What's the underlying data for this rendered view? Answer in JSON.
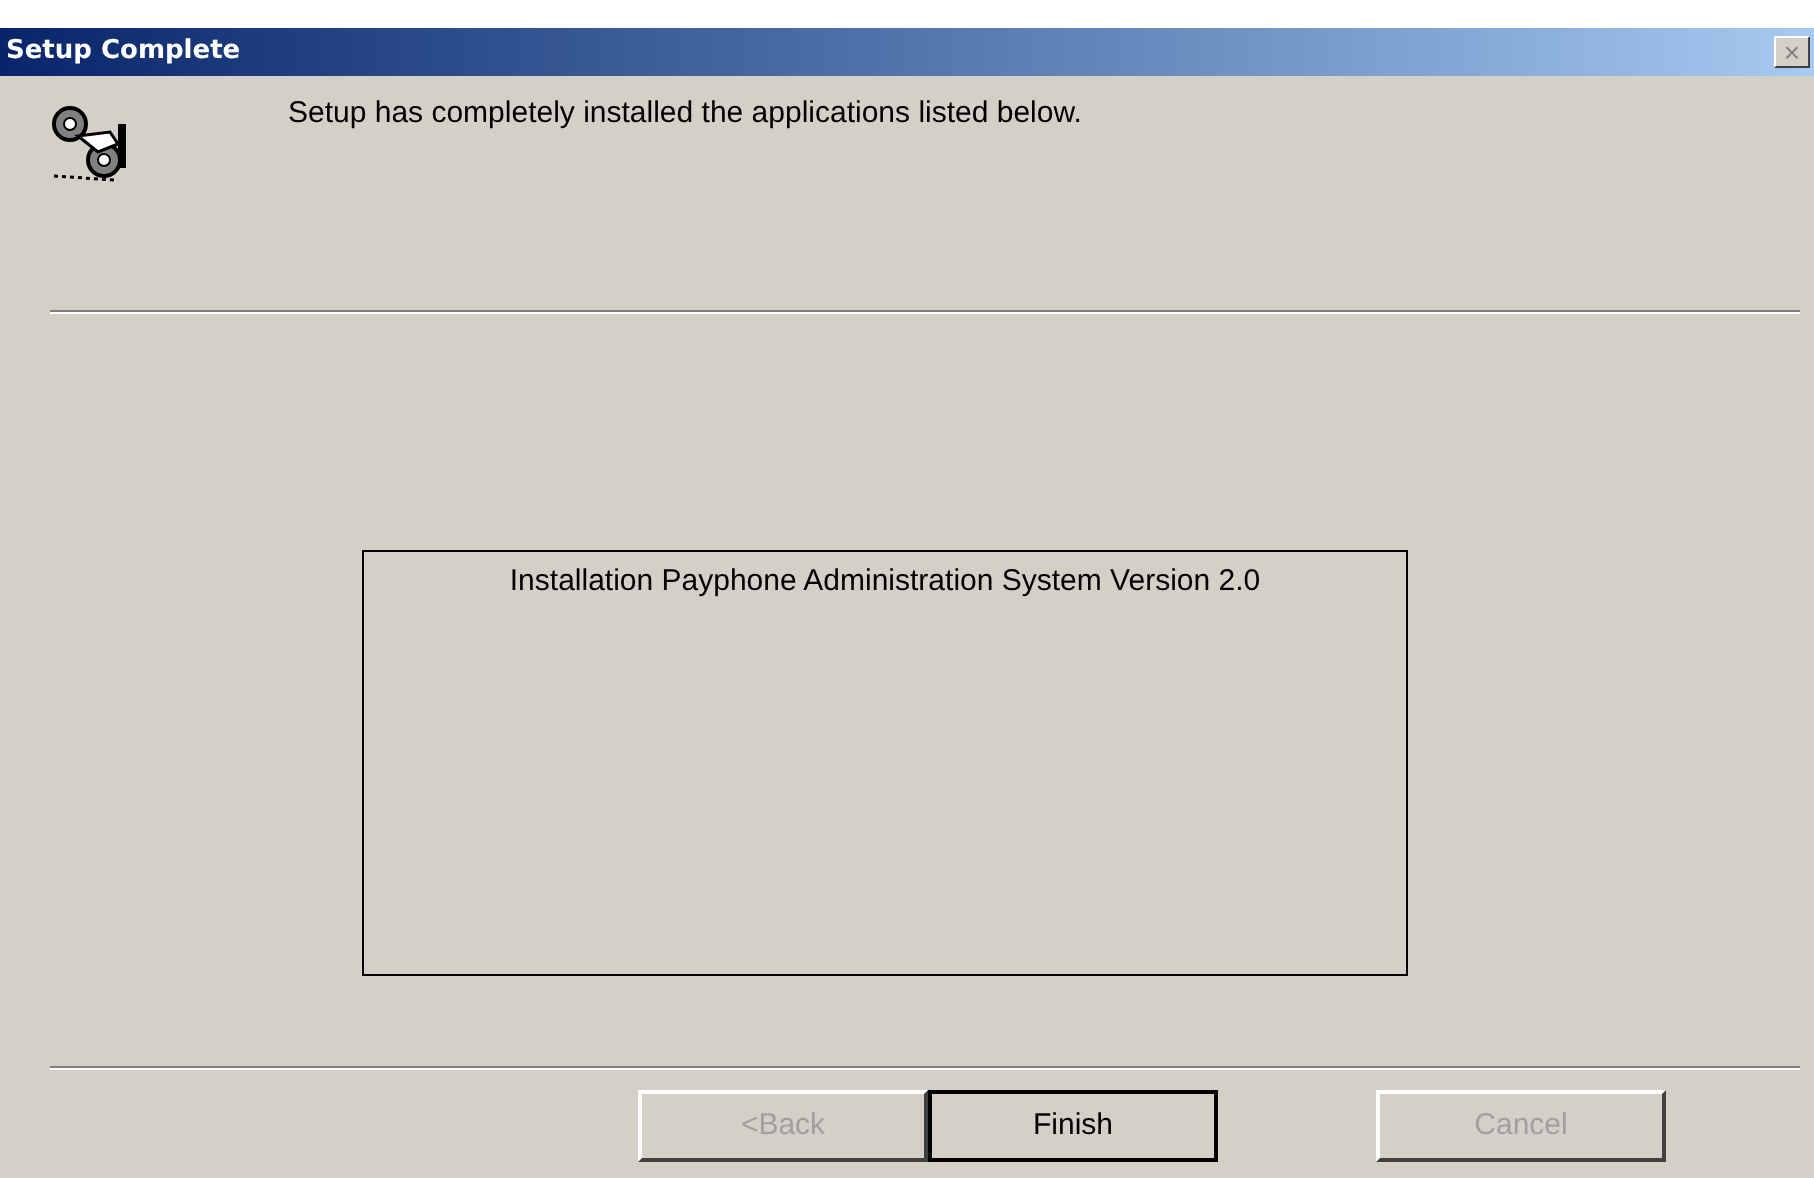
{
  "window": {
    "title": "Setup Complete",
    "close_button": {
      "label": "×",
      "disabled": true
    }
  },
  "header": {
    "message": "Setup has completely installed the applications listed below."
  },
  "installed_list": [
    "Installation Payphone Administration System Version 2.0"
  ],
  "buttons": [
    {
      "label": "<Back",
      "disabled": true,
      "default": false
    },
    {
      "label": "Finish",
      "disabled": false,
      "default": true
    },
    {
      "label": "Cancel",
      "disabled": true,
      "default": false
    }
  ]
}
